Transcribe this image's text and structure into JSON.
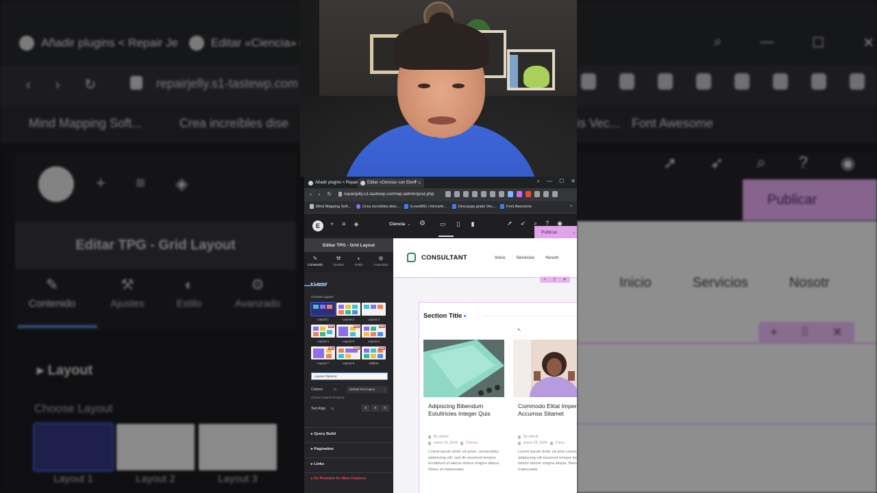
{
  "background": {
    "tabs": [
      "Añadir plugins < Repair Je",
      "Editar «Ciencia» c"
    ],
    "url": "repairjelly.s1-tastewp.com",
    "bookmarks": [
      "Mind Mapping Soft...",
      "Crea increíbles dise",
      "is Vec...",
      "Font Awesome"
    ],
    "editor_title": "Editar TPG - Grid Layout",
    "page_partial": "Ci",
    "tabs_panel": [
      "Contenido",
      "Ajustes",
      "Estilo",
      "Avanzado"
    ],
    "layout_heading": "Layout",
    "choose_layout": "Choose Layout",
    "layouts": [
      "Layout 1",
      "Layout 2",
      "Layout 3"
    ],
    "publish": "Publicar",
    "nav": [
      "Inicio",
      "Servicios",
      "Nosotr"
    ]
  },
  "browser": {
    "tabs": [
      {
        "label": "Añadir plugins < Repair Je"
      },
      {
        "label": "Editar «Ciencia» con Elem"
      }
    ],
    "url": "repairjelly.s1-tastewp.com/wp-admin/post.php",
    "bookmarks": [
      {
        "label": "Mind Mapping Soft..."
      },
      {
        "label": "Crea increíbles dise..."
      },
      {
        "label": "iLoveIMG | Herrami..."
      },
      {
        "label": "Descarga gratis Vec..."
      },
      {
        "label": "Font Awesome"
      }
    ]
  },
  "elementor": {
    "page_name": "Ciencia",
    "publish_label": "Publicar",
    "panel_title": "Editar TPG - Grid Layout",
    "tabs": [
      {
        "label": "Contenido",
        "icon": "pencil-icon"
      },
      {
        "label": "Ajustes",
        "icon": "wrench-icon"
      },
      {
        "label": "Estilo",
        "icon": "half-circle-icon"
      },
      {
        "label": "Avanzado",
        "icon": "gear-icon"
      }
    ],
    "layout_section": "Layout",
    "choose_layout": "Choose Layout",
    "layouts": [
      {
        "label": "Layout 1",
        "pro": false,
        "selected": true
      },
      {
        "label": "Layout 2",
        "pro": false
      },
      {
        "label": "Layout 3",
        "pro": false
      },
      {
        "label": "Layout 4",
        "pro": true
      },
      {
        "label": "Layout 5",
        "pro": true
      },
      {
        "label": "Layout 6",
        "pro": true
      },
      {
        "label": "Layout 7",
        "pro": true
      },
      {
        "label": "Layout 8",
        "pro": true
      },
      {
        "label": "Gallery",
        "pro": true
      }
    ],
    "pro_badge": "PRO",
    "layout_options": "Layout Options:",
    "column_label": "Column",
    "column_value": "Default from layou",
    "column_help": "Choose Column for layout.",
    "text_align_label": "Text Align",
    "sections": [
      "Query Build",
      "Pagination",
      "Links"
    ],
    "premium": "Go Premium for More Features"
  },
  "preview": {
    "brand": "CONSULTANT",
    "nav": [
      "Inicio",
      "Servicios",
      "Nosotr"
    ],
    "section_title": "Section Title",
    "cards": [
      {
        "title": "Adipiscing Bibendum Estultricies Integer Quis",
        "author": "By admin",
        "date": "enero 25, 2024",
        "category": "Ciencia",
        "excerpt": "Lorem ipsum dolor sit amet, consectetur adipiscing elit, sed do eiusmod tempor incididunt ut labore dolore magna aliqua. Netus et malesuada"
      },
      {
        "title": "Commodo Elitat Imperdiet Accumsa Sitamet",
        "author": "By admin",
        "date": "enero 25, 2024",
        "category": "Cienc",
        "excerpt": "Lorem ipsum dolor sit ame consectetur adipiscing elit eiusmod tempor incididun labore dolore magna aliqua. Netus et malesuada"
      }
    ]
  },
  "colors": {
    "accent_blue": "#4a90e2",
    "publish_pink": "#e0a4ec",
    "brand_green": "#1f8a5c",
    "premium_red": "#e24a4a"
  }
}
